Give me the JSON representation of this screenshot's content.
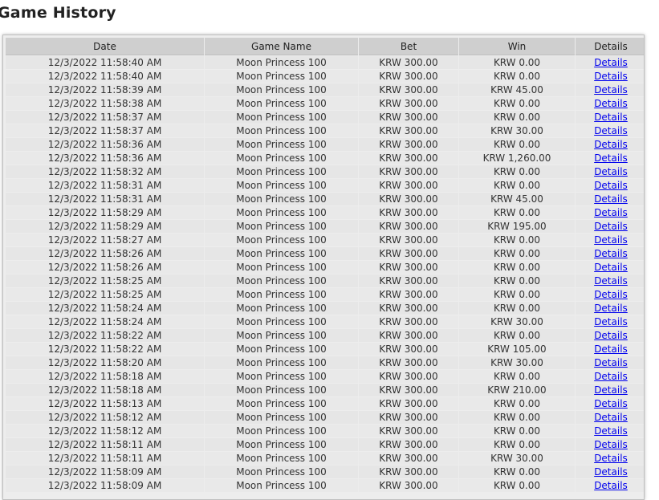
{
  "page": {
    "title": "Game History"
  },
  "table": {
    "headers": {
      "date": "Date",
      "game": "Game Name",
      "bet": "Bet",
      "win": "Win",
      "details": "Details"
    },
    "rows": [
      {
        "date": "12/3/2022 11:58:40 AM",
        "game": "Moon Princess 100",
        "bet": "KRW 300.00",
        "win": "KRW 0.00",
        "details": "Details"
      },
      {
        "date": "12/3/2022 11:58:40 AM",
        "game": "Moon Princess 100",
        "bet": "KRW 300.00",
        "win": "KRW 0.00",
        "details": "Details"
      },
      {
        "date": "12/3/2022 11:58:39 AM",
        "game": "Moon Princess 100",
        "bet": "KRW 300.00",
        "win": "KRW 45.00",
        "details": "Details"
      },
      {
        "date": "12/3/2022 11:58:38 AM",
        "game": "Moon Princess 100",
        "bet": "KRW 300.00",
        "win": "KRW 0.00",
        "details": "Details"
      },
      {
        "date": "12/3/2022 11:58:37 AM",
        "game": "Moon Princess 100",
        "bet": "KRW 300.00",
        "win": "KRW 0.00",
        "details": "Details"
      },
      {
        "date": "12/3/2022 11:58:37 AM",
        "game": "Moon Princess 100",
        "bet": "KRW 300.00",
        "win": "KRW 30.00",
        "details": "Details"
      },
      {
        "date": "12/3/2022 11:58:36 AM",
        "game": "Moon Princess 100",
        "bet": "KRW 300.00",
        "win": "KRW 0.00",
        "details": "Details"
      },
      {
        "date": "12/3/2022 11:58:36 AM",
        "game": "Moon Princess 100",
        "bet": "KRW 300.00",
        "win": "KRW 1,260.00",
        "details": "Details"
      },
      {
        "date": "12/3/2022 11:58:32 AM",
        "game": "Moon Princess 100",
        "bet": "KRW 300.00",
        "win": "KRW 0.00",
        "details": "Details"
      },
      {
        "date": "12/3/2022 11:58:31 AM",
        "game": "Moon Princess 100",
        "bet": "KRW 300.00",
        "win": "KRW 0.00",
        "details": "Details"
      },
      {
        "date": "12/3/2022 11:58:31 AM",
        "game": "Moon Princess 100",
        "bet": "KRW 300.00",
        "win": "KRW 45.00",
        "details": "Details"
      },
      {
        "date": "12/3/2022 11:58:29 AM",
        "game": "Moon Princess 100",
        "bet": "KRW 300.00",
        "win": "KRW 0.00",
        "details": "Details"
      },
      {
        "date": "12/3/2022 11:58:29 AM",
        "game": "Moon Princess 100",
        "bet": "KRW 300.00",
        "win": "KRW 195.00",
        "details": "Details"
      },
      {
        "date": "12/3/2022 11:58:27 AM",
        "game": "Moon Princess 100",
        "bet": "KRW 300.00",
        "win": "KRW 0.00",
        "details": "Details"
      },
      {
        "date": "12/3/2022 11:58:26 AM",
        "game": "Moon Princess 100",
        "bet": "KRW 300.00",
        "win": "KRW 0.00",
        "details": "Details"
      },
      {
        "date": "12/3/2022 11:58:26 AM",
        "game": "Moon Princess 100",
        "bet": "KRW 300.00",
        "win": "KRW 0.00",
        "details": "Details"
      },
      {
        "date": "12/3/2022 11:58:25 AM",
        "game": "Moon Princess 100",
        "bet": "KRW 300.00",
        "win": "KRW 0.00",
        "details": "Details"
      },
      {
        "date": "12/3/2022 11:58:25 AM",
        "game": "Moon Princess 100",
        "bet": "KRW 300.00",
        "win": "KRW 0.00",
        "details": "Details"
      },
      {
        "date": "12/3/2022 11:58:24 AM",
        "game": "Moon Princess 100",
        "bet": "KRW 300.00",
        "win": "KRW 0.00",
        "details": "Details"
      },
      {
        "date": "12/3/2022 11:58:24 AM",
        "game": "Moon Princess 100",
        "bet": "KRW 300.00",
        "win": "KRW 30.00",
        "details": "Details"
      },
      {
        "date": "12/3/2022 11:58:22 AM",
        "game": "Moon Princess 100",
        "bet": "KRW 300.00",
        "win": "KRW 0.00",
        "details": "Details"
      },
      {
        "date": "12/3/2022 11:58:22 AM",
        "game": "Moon Princess 100",
        "bet": "KRW 300.00",
        "win": "KRW 105.00",
        "details": "Details"
      },
      {
        "date": "12/3/2022 11:58:20 AM",
        "game": "Moon Princess 100",
        "bet": "KRW 300.00",
        "win": "KRW 30.00",
        "details": "Details"
      },
      {
        "date": "12/3/2022 11:58:18 AM",
        "game": "Moon Princess 100",
        "bet": "KRW 300.00",
        "win": "KRW 0.00",
        "details": "Details"
      },
      {
        "date": "12/3/2022 11:58:18 AM",
        "game": "Moon Princess 100",
        "bet": "KRW 300.00",
        "win": "KRW 210.00",
        "details": "Details"
      },
      {
        "date": "12/3/2022 11:58:13 AM",
        "game": "Moon Princess 100",
        "bet": "KRW 300.00",
        "win": "KRW 0.00",
        "details": "Details"
      },
      {
        "date": "12/3/2022 11:58:12 AM",
        "game": "Moon Princess 100",
        "bet": "KRW 300.00",
        "win": "KRW 0.00",
        "details": "Details"
      },
      {
        "date": "12/3/2022 11:58:12 AM",
        "game": "Moon Princess 100",
        "bet": "KRW 300.00",
        "win": "KRW 0.00",
        "details": "Details"
      },
      {
        "date": "12/3/2022 11:58:11 AM",
        "game": "Moon Princess 100",
        "bet": "KRW 300.00",
        "win": "KRW 0.00",
        "details": "Details"
      },
      {
        "date": "12/3/2022 11:58:11 AM",
        "game": "Moon Princess 100",
        "bet": "KRW 300.00",
        "win": "KRW 30.00",
        "details": "Details"
      },
      {
        "date": "12/3/2022 11:58:09 AM",
        "game": "Moon Princess 100",
        "bet": "KRW 300.00",
        "win": "KRW 0.00",
        "details": "Details"
      },
      {
        "date": "12/3/2022 11:58:09 AM",
        "game": "Moon Princess 100",
        "bet": "KRW 300.00",
        "win": "KRW 0.00",
        "details": "Details"
      }
    ]
  }
}
